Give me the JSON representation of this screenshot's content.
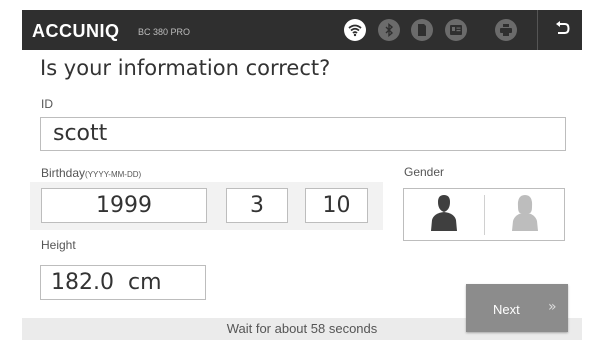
{
  "header": {
    "brand": "ACCUNIQ",
    "model": "BC 380 PRO",
    "icons": {
      "wifi": "wifi-icon",
      "bluetooth": "bluetooth-icon",
      "sd_card": "sd-card-icon",
      "id_card": "id-card-icon",
      "printer": "printer-icon",
      "back": "back-arrow-icon"
    },
    "active_color": "#ffffff",
    "inactive_color": "#6b6b6b"
  },
  "title": "Is your information correct?",
  "id": {
    "label": "ID",
    "value": "scott"
  },
  "birthday": {
    "label": "Birthday",
    "format": "(YYYY-MM-DD)",
    "year": "1999",
    "month": "3",
    "day": "10"
  },
  "gender": {
    "label": "Gender",
    "male_icon": "male-icon",
    "female_icon": "female-icon",
    "selected": "male"
  },
  "height": {
    "label": "Height",
    "value": "182.0  cm"
  },
  "footer": {
    "wait_prefix": "Wait for about ",
    "wait_seconds": "58",
    "wait_suffix": " seconds"
  },
  "next": {
    "label": "Next",
    "arrow": "»"
  }
}
